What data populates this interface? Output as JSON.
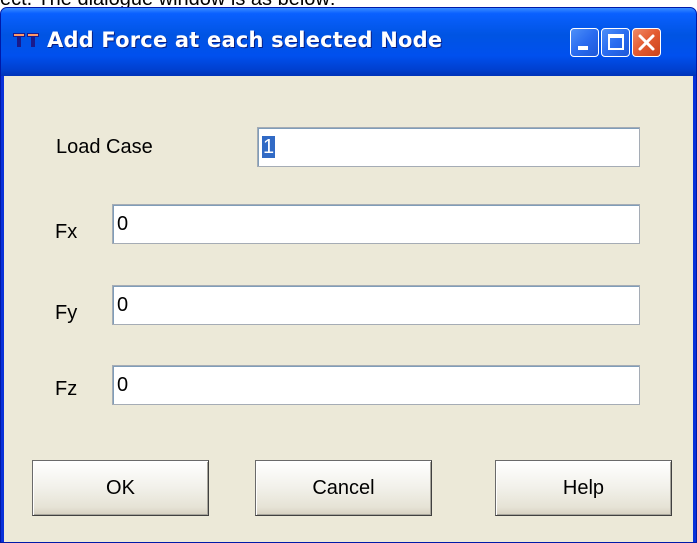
{
  "caption": "ect. The dialogue window is as below:",
  "window": {
    "title": "Add Force at each selected Node",
    "app_icon": "cad-app-icon",
    "controls": {
      "minimize_icon": "minimize-icon",
      "maximize_icon": "maximize-icon",
      "close_icon": "close-icon"
    }
  },
  "form": {
    "load_case": {
      "label": "Load Case",
      "value": "1"
    },
    "fx": {
      "label": "Fx",
      "value": "0"
    },
    "fy": {
      "label": "Fy",
      "value": "0"
    },
    "fz": {
      "label": "Fz",
      "value": "0"
    }
  },
  "buttons": {
    "ok": "OK",
    "cancel": "Cancel",
    "help": "Help"
  },
  "colors": {
    "title_bar": "#0054e3",
    "client_bg": "#ece9d8",
    "close_button": "#e35a30",
    "selection": "#316ac5"
  }
}
